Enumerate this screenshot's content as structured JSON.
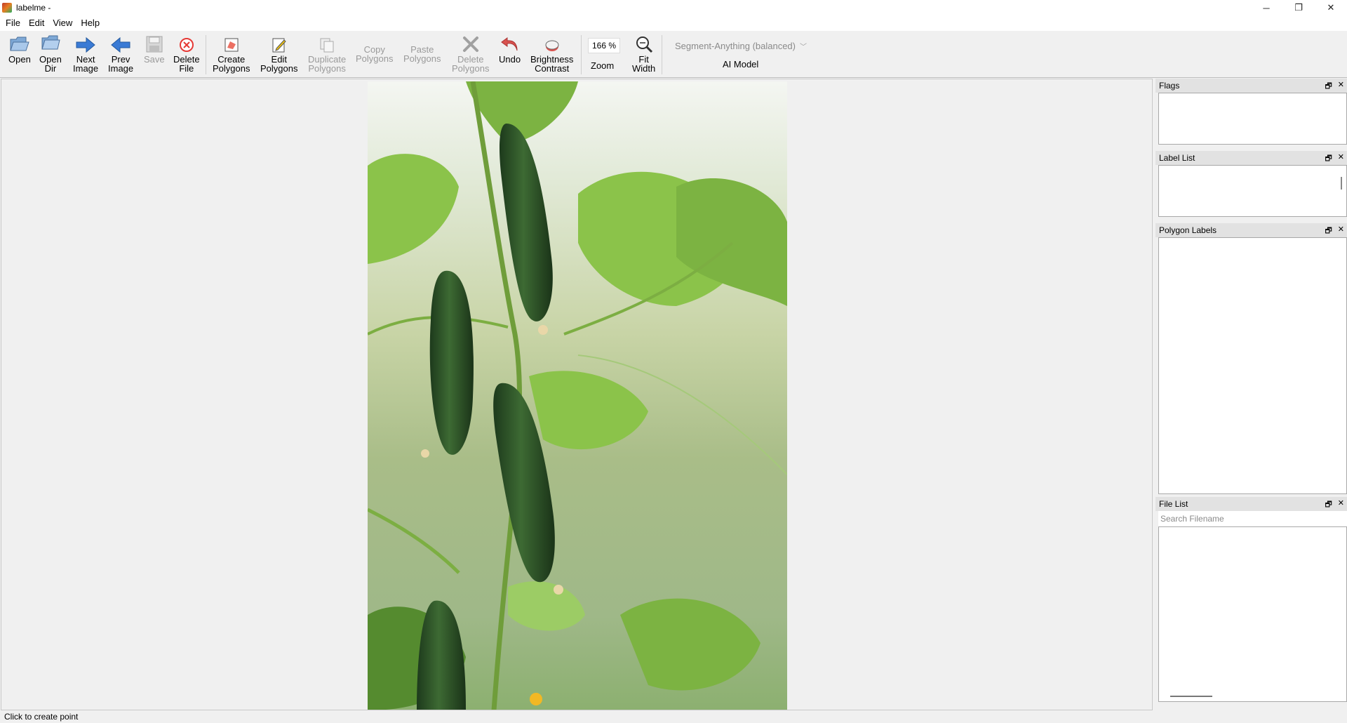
{
  "window": {
    "title": "labelme -",
    "controls": {
      "minimize": "─",
      "restore": "❐",
      "close": "✕"
    }
  },
  "menu": {
    "items": [
      "File",
      "Edit",
      "View",
      "Help"
    ]
  },
  "toolbar": {
    "open": "Open",
    "open_dir": [
      "Open",
      "Dir"
    ],
    "next_image": [
      "Next",
      "Image"
    ],
    "prev_image": [
      "Prev",
      "Image"
    ],
    "save": "Save",
    "delete_file": [
      "Delete",
      "File"
    ],
    "create_polygons": [
      "Create",
      "Polygons"
    ],
    "edit_polygons": [
      "Edit",
      "Polygons"
    ],
    "duplicate_polygons": [
      "Duplicate",
      "Polygons"
    ],
    "copy_polygons": [
      "Copy",
      "Polygons"
    ],
    "paste_polygons": [
      "Paste",
      "Polygons"
    ],
    "delete_polygons": [
      "Delete",
      "Polygons"
    ],
    "undo": "Undo",
    "brightness_contrast": [
      "Brightness",
      "Contrast"
    ],
    "zoom_value": "166 %",
    "zoom_label": "Zoom",
    "fit_width": [
      "Fit",
      "Width"
    ],
    "ai_model_value": "Segment-Anything (balanced)",
    "ai_model_label": "AI Model"
  },
  "docks": {
    "flags": "Flags",
    "label_list": "Label List",
    "polygon_labels": "Polygon Labels",
    "file_list": "File List",
    "search_placeholder": "Search Filename",
    "float_glyph": "🗗",
    "close_glyph": "✕"
  },
  "status": {
    "text": "Click to create point"
  },
  "colors": {
    "accent_blue": "#3a7bd5",
    "delete_red": "#e53935",
    "undo_red": "#d9534f"
  }
}
